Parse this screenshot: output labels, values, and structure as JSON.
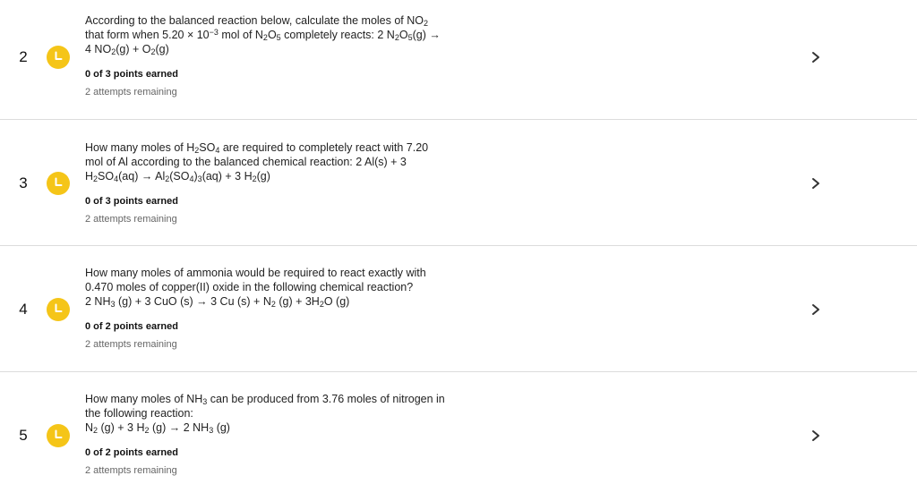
{
  "colors": {
    "status_pending": "#f5c518",
    "divider": "#dcdcdc"
  },
  "icons": {
    "status": "clock-icon",
    "open": "chevron-right-icon"
  },
  "questions": [
    {
      "number": "2",
      "q": {
        "l1a": "According to the balanced reaction below, calculate the moles of NO",
        "l1s": "2",
        "l2a": "that form when 5.20 × 10",
        "l2sup": "−3",
        "l2b": " mol of N",
        "l2s1": "2",
        "l2c": "O",
        "l2s2": "5",
        "l2d": " completely reacts: 2 N",
        "l2s3": "2",
        "l2e": "O",
        "l2s4": "5",
        "l2f": "(g) →",
        "l3a": "4 NO",
        "l3s1": "2",
        "l3b": "(g) + O",
        "l3s2": "2",
        "l3c": "(g)"
      },
      "points": "0 of 3 points earned",
      "attempts": "2 attempts remaining"
    },
    {
      "number": "3",
      "q": {
        "l1a": "How many moles of H",
        "l1s1": "2",
        "l1b": "SO",
        "l1s2": "4",
        "l1c": " are required to completely react with 7.20",
        "l2": "mol of Al according to the balanced chemical reaction: 2 Al(s) + 3",
        "l3a": "H",
        "l3s1": "2",
        "l3b": "SO",
        "l3s2": "4",
        "l3c": "(aq) → Al",
        "l3s3": "2",
        "l3d": "(SO",
        "l3s4": "4",
        "l3e": ")",
        "l3s5": "3",
        "l3f": "(aq) + 3 H",
        "l3s6": "2",
        "l3g": "(g)"
      },
      "points": "0 of 3 points earned",
      "attempts": "2 attempts remaining"
    },
    {
      "number": "4",
      "q": {
        "l1": "How many moles of ammonia would be required to react exactly with",
        "l2": "0.470 moles of copper(II) oxide in the following chemical reaction?",
        "l3a": "2 NH",
        "l3s1": "3",
        "l3b": " (g) + 3 CuO (s) → 3 Cu (s) + N",
        "l3s2": "2",
        "l3c": " (g) + 3H",
        "l3s3": "2",
        "l3d": "O (g)"
      },
      "points": "0 of 2 points earned",
      "attempts": "2 attempts remaining"
    },
    {
      "number": "5",
      "q": {
        "l1a": "How many moles of NH",
        "l1s1": "3",
        "l1b": " can be produced from 3.76 moles of nitrogen in",
        "l2": "the following reaction:",
        "l3a": "N",
        "l3s1": "2",
        "l3b": " (g) + 3 H",
        "l3s2": "2",
        "l3c": " (g) → 2 NH",
        "l3s3": "3",
        "l3d": " (g)"
      },
      "points": "0 of 2 points earned",
      "attempts": "2 attempts remaining"
    }
  ]
}
